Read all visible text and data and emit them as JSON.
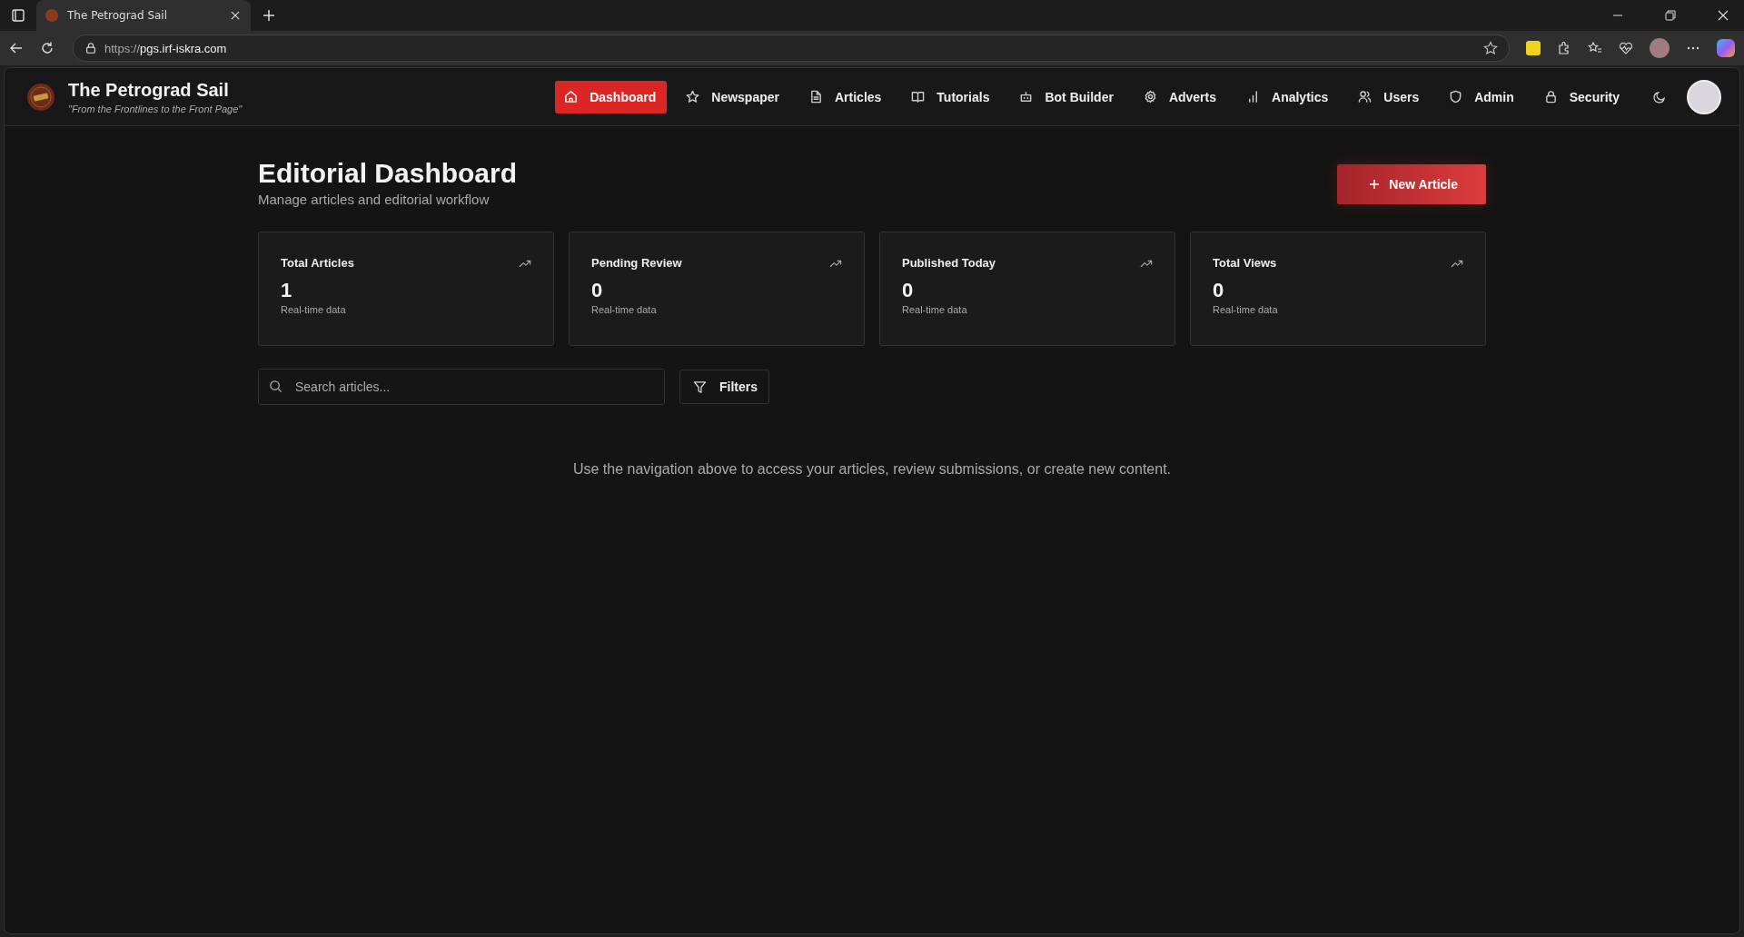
{
  "browser": {
    "tab": {
      "title": "The Petrograd Sail",
      "selected": true
    },
    "url_scheme": "https://",
    "url_host": "pgs.irf-iskra.com"
  },
  "header": {
    "title": "The Petrograd Sail",
    "tagline": "\"From the Frontlines to the Front Page\""
  },
  "nav": [
    {
      "label": "Dashboard",
      "selected": true
    },
    {
      "label": "Newspaper",
      "selected": false
    },
    {
      "label": "Articles",
      "selected": false
    },
    {
      "label": "Tutorials",
      "selected": false
    },
    {
      "label": "Bot Builder",
      "selected": false
    },
    {
      "label": "Adverts",
      "selected": false
    },
    {
      "label": "Analytics",
      "selected": false
    },
    {
      "label": "Users",
      "selected": false
    },
    {
      "label": "Admin",
      "selected": false
    },
    {
      "label": "Security",
      "selected": false
    }
  ],
  "page": {
    "title": "Editorial Dashboard",
    "subtitle": "Manage articles and editorial workflow",
    "new_button": "New Article"
  },
  "stats": [
    {
      "label": "Total Articles",
      "value": "1",
      "note": "Real-time data"
    },
    {
      "label": "Pending Review",
      "value": "0",
      "note": "Real-time data"
    },
    {
      "label": "Published Today",
      "value": "0",
      "note": "Real-time data"
    },
    {
      "label": "Total Views",
      "value": "0",
      "note": "Real-time data"
    }
  ],
  "search": {
    "placeholder": "Search articles..."
  },
  "filters_button": "Filters",
  "message": "Use the navigation above to access your articles, review submissions, or create new content."
}
